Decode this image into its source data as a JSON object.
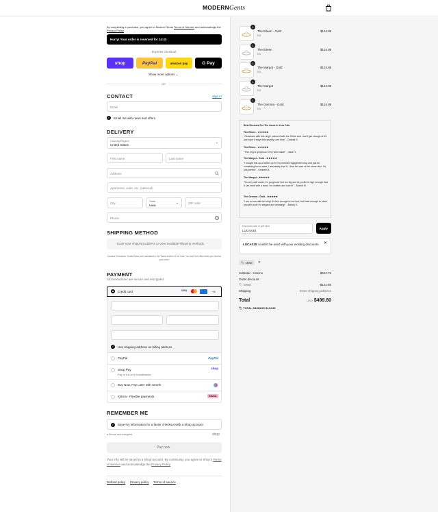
{
  "header": {
    "brand": "MODERN",
    "brand_script": "Gents",
    "cart_icon": "shopping-bag-icon"
  },
  "checkout": {
    "agree_prefix": "By completing a purchase, you agree to Modern Gents",
    "terms_link": "Terms of Service",
    "agree_mid": "and acknowledge the",
    "privacy_link": "Privacy Policy",
    "hurry_banner": "Hurry! Your order is reserved for 14:43",
    "express_label": "Express checkout",
    "express_buttons": {
      "shop": "shop",
      "paypal": "PayPal",
      "amazon": "amazon pay",
      "gpay": "G Pay"
    },
    "show_more": "Show more options",
    "or": "OR",
    "contact_heading": "CONTACT",
    "sign_in": "Sign in",
    "email_placeholder": "Email",
    "email_news": "Email me with news and offers",
    "delivery_heading": "DELIVERY",
    "country_label": "Country/Region",
    "country_value": "United States",
    "first_name": "First name",
    "last_name": "Last name",
    "address": "Address",
    "apartment": "Apartment, suite, etc. (optional)",
    "city": "City",
    "state_label": "State",
    "state_value": "Iowa",
    "zip": "ZIP code",
    "phone": "Phone",
    "shipping_heading": "SHIPPING METHOD",
    "shipping_note": "Enter your shipping address to view available shipping methods.",
    "duties_note": "Canada Exclusives: Duties/Taxes are calculated in the Taxes section of the total. You won't be billed when you receive your order.",
    "payment_heading": "PAYMENT",
    "payment_sub": "All transactions are secure and encrypted.",
    "credit_card": "Credit card",
    "card_more": "+5",
    "billing_same": "Use shipping address as billing address",
    "paypal_option": "PayPal",
    "paypal_logo": "PayPal",
    "shoppay_option": "Shop Pay",
    "shoppay_sub": "Pay in full or in installments",
    "shoppay_logo": "shop",
    "sezzle_option": "Buy Now, Pay Later with Sezzle",
    "klarna_option": "Klarna - Flexible payments",
    "klarna_logo": "Klarna.",
    "remember_heading": "REMEMBER ME",
    "save_info": "Save my information for a faster checkout with a Shop account",
    "secure_note": "Secure and encrypted",
    "shop_logo": "shop",
    "pay_now": "Pay now",
    "shop_note_1": "Your info will be saved to a Shop account. By continuing, you agree to Shop's",
    "shop_terms": "Terms of Service",
    "shop_note_2": "and acknowledge the",
    "shop_privacy": "Privacy Policy",
    "footer_links": [
      "Refund policy",
      "Privacy policy",
      "Terms of service"
    ]
  },
  "cart": {
    "items": [
      {
        "qty": "1",
        "name": "The Eileen - Gold",
        "size": "5.5",
        "price": "$124.95"
      },
      {
        "qty": "1",
        "name": "The Eileen",
        "size": "5.5",
        "price": "$124.95"
      },
      {
        "qty": "1",
        "name": "The Margot - Gold",
        "size": "5.5",
        "price": "$124.95"
      },
      {
        "qty": "1",
        "name": "The Margot",
        "size": "5.5",
        "price": "$124.95"
      },
      {
        "qty": "1",
        "name": "The Gemma - Gold",
        "size": "5.5",
        "price": "$124.95"
      }
    ],
    "reviews_title": "Best Reviews For The Items In Your Cart",
    "reviews": [
      {
        "title": "The Eileen - ★★★★★",
        "text": "\"Obsessed with this ring! I paired it with the Chloe and I can't get enough of it! I just hope it stays this sparkly over time\" - Dakota S."
      },
      {
        "title": "The Eileen - ★★★★★",
        "text": "\"This ring is gorgeous! Very well made!\" - Jana H."
      },
      {
        "title": "The Margot - Gold - ★★★★★",
        "text": "\"I bought this as a switch up for my normal engagement ring and just for something fun to wear. I absolutely love it. I love the size of the stone also, it's just perfect\" - Kimberli B."
      },
      {
        "title": "The Margot - ★★★★★",
        "text": "\"So very well made, it's gorgeous! Not too big and its profile is high enough that it can work with a band. I'm smitten and love it!\" - Brandi M."
      },
      {
        "title": "The Gemma - Gold - ★★★★★",
        "text": "\"I am in love with the ring! It's thin enough to not hurt, but thick enough to catch people's eye! It's elegant and amazing!\" - Ashley S."
      }
    ],
    "discount_label": "Discount code or gift card",
    "discount_value": "LUCAS18",
    "apply": "Apply",
    "error_code": "LUCAS18",
    "error_text": "couldn't be used with your existing discounts.",
    "tag": "MINE",
    "subtotal_label": "Subtotal · 5 items",
    "subtotal": "$624.75",
    "order_discount": "Order discount",
    "discount_tag": "MINE",
    "discount_amount": "-$124.95",
    "shipping_label": "Shipping",
    "shipping_value": "Enter shipping address",
    "total_label": "Total",
    "currency": "USD",
    "total": "$499.80",
    "savings_label": "TOTAL SAVINGS",
    "savings": "$124.95"
  },
  "colors": {
    "shop": "#5a31f4",
    "paypal": "#ffc439",
    "amazon": "#ffd814",
    "gpay": "#000000",
    "accent": "#1773b0"
  }
}
